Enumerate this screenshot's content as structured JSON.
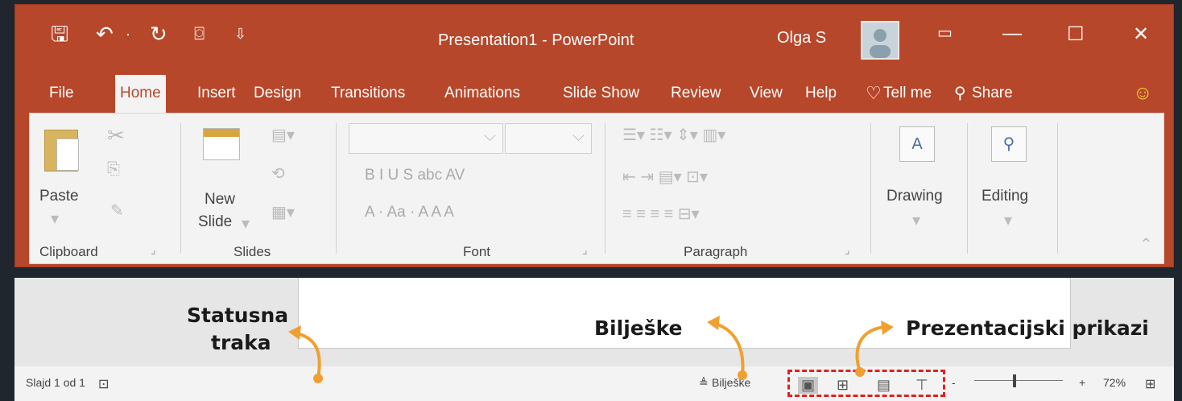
{
  "titlebar": {
    "title": "Presentation1  -  PowerPoint",
    "user": "Olga S",
    "icons": [
      "save-icon",
      "undo-icon",
      "redo-icon",
      "presenter-icon",
      "customize-icon"
    ]
  },
  "tabs": [
    "File",
    "Home",
    "Insert",
    "Design",
    "Transitions",
    "Animations",
    "Slide Show",
    "Review",
    "View",
    "Help"
  ],
  "tellme": "Tell me",
  "share": "Share",
  "ribbon": {
    "clipboard": {
      "paste": "Paste",
      "label": "Clipboard"
    },
    "slides": {
      "new_line1": "New",
      "new_line2": "Slide",
      "label": "Slides"
    },
    "font": {
      "label": "Font",
      "row1": "B  I  U  S  abc  AV",
      "row2": "A  ·  Aa ·  A  A  A"
    },
    "paragraph": {
      "label": "Paragraph"
    },
    "drawing": {
      "label": "Drawing"
    },
    "editing": {
      "label": "Editing"
    }
  },
  "statusbar": {
    "slide_info": "Slajd 1 od 1",
    "notes": "Bilješke",
    "zoom_minus": "-",
    "zoom_plus": "+",
    "zoom": "72%"
  },
  "annotations": {
    "status_line1": "Statusna",
    "status_line2": "traka",
    "notes": "Bilješke",
    "views": "Prezentacijski prikazi"
  },
  "colors": {
    "accent": "#b7472a",
    "annotation_arrow": "#f0a030",
    "highlight_box": "#e02020"
  }
}
